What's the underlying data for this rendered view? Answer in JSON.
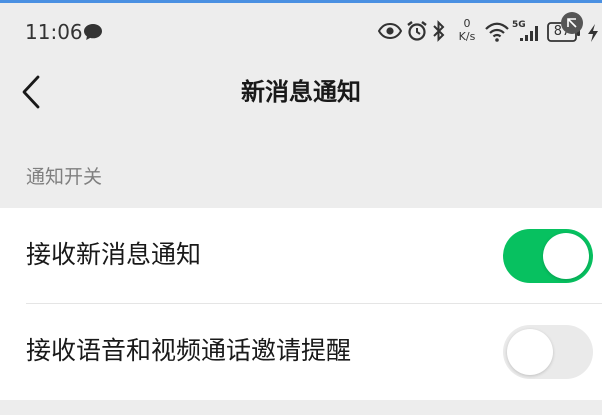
{
  "status_bar": {
    "time": "11:06",
    "net_speed_value": "0",
    "net_speed_unit": "K/s",
    "signal_label": "5G",
    "battery_level": "87",
    "icons": [
      "chat-bubble-icon",
      "eye-icon",
      "alarm-icon",
      "bluetooth-icon",
      "wifi-icon",
      "signal-icon",
      "battery-icon",
      "charging-icon"
    ]
  },
  "nav": {
    "title": "新消息通知",
    "back_icon": "chevron-left-icon"
  },
  "section": {
    "header": "通知开关"
  },
  "settings": [
    {
      "label": "接收新消息通知",
      "enabled": true
    },
    {
      "label": "接收语音和视频通话邀请提醒",
      "enabled": false
    }
  ],
  "colors": {
    "accent": "#07c160",
    "background": "#ededed",
    "toggle_off": "#eaeaea"
  }
}
